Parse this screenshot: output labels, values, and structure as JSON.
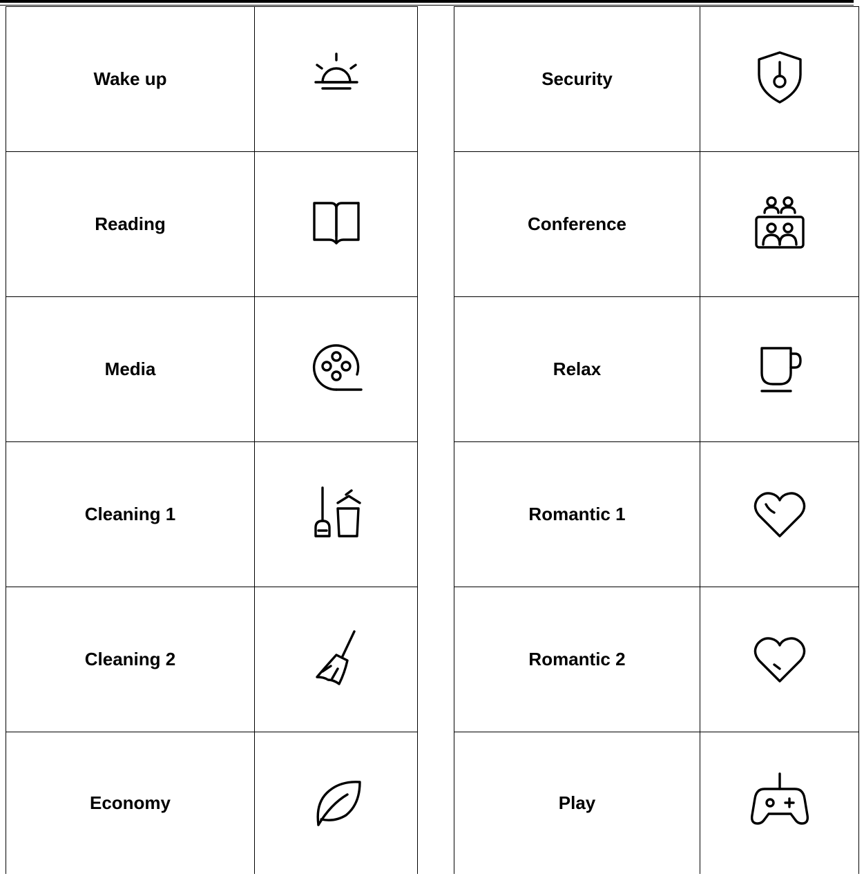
{
  "left_table": {
    "rows": [
      {
        "label": "Wake up",
        "icon": "sunrise-icon"
      },
      {
        "label": "Reading",
        "icon": "open-book-icon"
      },
      {
        "label": "Media",
        "icon": "film-reel-icon"
      },
      {
        "label": "Cleaning 1",
        "icon": "dustpan-trash-icon"
      },
      {
        "label": "Cleaning 2",
        "icon": "broom-icon"
      },
      {
        "label": "Economy",
        "icon": "leaf-icon"
      }
    ]
  },
  "right_table": {
    "rows": [
      {
        "label": "Security",
        "icon": "shield-key-icon"
      },
      {
        "label": "Conference",
        "icon": "meeting-people-icon"
      },
      {
        "label": "Relax",
        "icon": "cup-icon"
      },
      {
        "label": "Romantic 1",
        "icon": "heart-icon"
      },
      {
        "label": "Romantic 2",
        "icon": "heart-icon"
      },
      {
        "label": "Play",
        "icon": "gamepad-icon"
      }
    ]
  }
}
